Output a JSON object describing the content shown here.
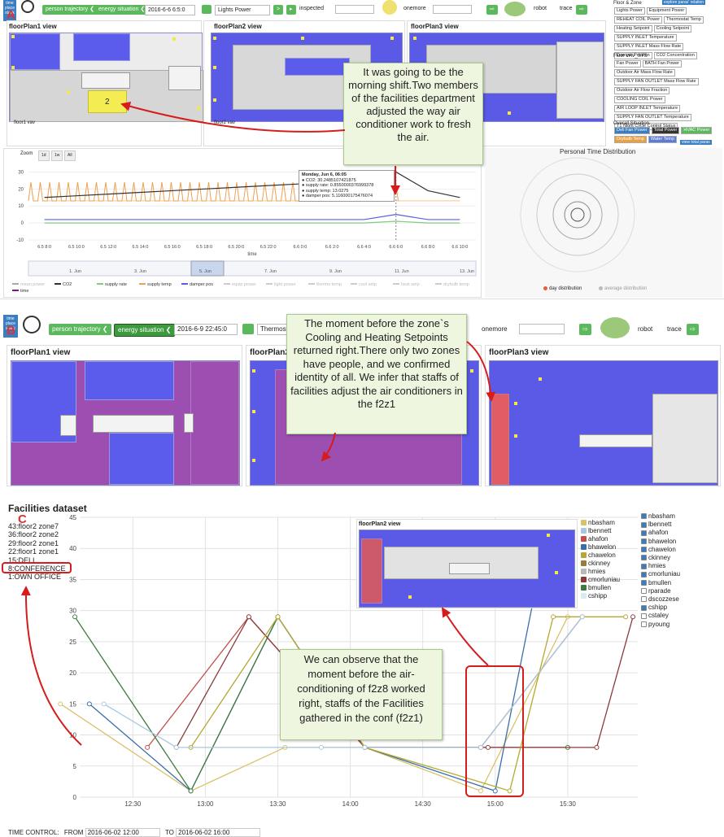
{
  "panelA": {
    "letter": "A",
    "toolbar": {
      "tps": "time\nplace\nstack",
      "person_btn": "person trajectory ❮",
      "energy_btn": "energy situation ❮",
      "date": "2016-6-6 6:5:0",
      "metric": "Lights Power",
      "inspected": "inspected",
      "onemore": "onemore",
      "robot": "robot",
      "trace": "trace"
    },
    "views": [
      "floorPlan1 view",
      "floorPlan2 view",
      "floorPlan3 view"
    ],
    "vav_labels": [
      "floor1 vav",
      "floor2 vav"
    ],
    "side": {
      "h1": "Floor & Zone",
      "explore": "explore paras' relation",
      "floor_tags": [
        "Lights Power",
        "Equipment Power",
        "REHEAT COIL Power",
        "Thermostat Temp",
        "Heating Setpoint",
        "Cooling Setpoint",
        "SUPPLY INLET Temperature",
        "SUPPLY INLET Mass Flow Rate",
        "Damper Position",
        "CO2 Concentration"
      ],
      "h2": "Floor VAV_SYS",
      "vav_tags": [
        "Fan Power",
        "BATH Fan Power",
        "Outdoor Air Mass Flow Rate",
        "SUPPLY FAN OUTLET Mass Flow Rate",
        "Outdoor Air Flow Fraction",
        "COOLING COIL Power",
        "AIR LOOP INLET Temperature",
        "SUPPLY FAN OUTLET Temperature",
        "T1 Night Cycle Control Status"
      ],
      "h3": "Overall Situation",
      "overall_tags": [
        "Deli Fan Power",
        "Total Power",
        "HVAC Power",
        "Drybulb Temp",
        "Water Temp"
      ],
      "view_total": "view total paras"
    },
    "chart": {
      "zoom_label": "Zoom",
      "zoom_opts": [
        "1d",
        "1w",
        "All"
      ],
      "y_ticks": [
        "30",
        "20",
        "10",
        "0",
        "-10"
      ],
      "x_ticks": [
        "6.5 8:0",
        "6.5 10:0",
        "6.5 12:0",
        "6.5 14:0",
        "6.5 16:0",
        "6.5 18:0",
        "6.5 20:0",
        "6.5 22:0",
        "6.6 0:0",
        "6.6 2:0",
        "6.6 4:0",
        "6.6 6:0",
        "6.6 8:0",
        "6.6 10:0"
      ],
      "x_title": "time",
      "nav_ticks": [
        "1. Jun",
        "3. Jun",
        "5. Jun",
        "7. Jun",
        "9. Jun",
        "11. Jun",
        "13. Jun"
      ],
      "tooltip": [
        "Monday, Jun 6, 06:05",
        "● CO2: 30.2485107421875",
        "● supply rate: 0.8550000376999378",
        "● supply temp: 13.0275",
        "● damper pos: 5.116000175476074"
      ],
      "legend": [
        "mean power",
        "CO2",
        "supply rate",
        "supply temp",
        "damper pos",
        "equip power",
        "light power",
        "thermo temp",
        "cool setp",
        "heat setp",
        "drybulb temp",
        "time"
      ]
    },
    "personal": {
      "title": "Personal Time Distribution",
      "legend": [
        "day distribution",
        "average distribution"
      ]
    },
    "callout": "It was going to be the morning shift.Two members of the facilities department adjusted the way air conditioner work to fresh the air.",
    "room_label": "2"
  },
  "panelB": {
    "letter": "B",
    "toolbar": {
      "tps": "time\nplace\nstack",
      "person_btn": "person trajectory ❮",
      "energy_btn": "energy situation ❮",
      "date": "2016-6-9 22:45:0",
      "metric": "Thermostat Temp",
      "onemore": "onemore",
      "robot": "robot",
      "trace": "trace"
    },
    "views": [
      "floorPlan1 view",
      "floorPlan2 view",
      "floorPlan3 view"
    ],
    "callout": "The moment before the zone`s Cooling and Heating Setpoints returned right.There only two zones have people, and we confirmed identity of all. We infer that staffs of facilities adjust the air conditioners  in the f2z1"
  },
  "panelC": {
    "letter": "C",
    "title": "Facilities dataset",
    "zones": [
      "43:floor2 zone7",
      "36:floor2 zone2",
      "29:floor2 zone1",
      "22:floor1 zone1",
      "15:DELI",
      "8:CONFERENCE",
      "1:OWN OFFICE"
    ],
    "y_ticks": [
      "45",
      "40",
      "35",
      "30",
      "25",
      "20",
      "15",
      "10",
      "5",
      "0"
    ],
    "x_ticks": [
      "12:30",
      "13:00",
      "13:30",
      "14:00",
      "14:30",
      "15:00",
      "15:30"
    ],
    "inset_title": "floorPlan2 view",
    "callout": "We can observe that the moment before the air-conditioning of f2z8 worked right, staffs of the Facilities gathered in the conf (f2z1)",
    "legend_series": [
      {
        "name": "nbasham",
        "color": "#d8c36a"
      },
      {
        "name": "lbennett",
        "color": "#a8c8e0"
      },
      {
        "name": "ahafon",
        "color": "#c0504d"
      },
      {
        "name": "bhawelon",
        "color": "#3a6fa8"
      },
      {
        "name": "chawelon",
        "color": "#b5a832"
      },
      {
        "name": "ckinney",
        "color": "#9b7c3e"
      },
      {
        "name": "hmies",
        "color": "#b9b9b9"
      },
      {
        "name": "cmorluniau",
        "color": "#8b3a3a"
      },
      {
        "name": "bmullen",
        "color": "#3f7a3f"
      },
      {
        "name": "cshipp",
        "color": "#d9ecec"
      }
    ],
    "checklist": [
      {
        "name": "nbasham",
        "on": true
      },
      {
        "name": "lbennett",
        "on": true
      },
      {
        "name": "ahafon",
        "on": true
      },
      {
        "name": "bhawelon",
        "on": true
      },
      {
        "name": "chawelon",
        "on": true
      },
      {
        "name": "ckinney",
        "on": true
      },
      {
        "name": "hmies",
        "on": true
      },
      {
        "name": "cmorluniau",
        "on": true
      },
      {
        "name": "bmullen",
        "on": true
      },
      {
        "name": "rparade",
        "on": false
      },
      {
        "name": "dscozzese",
        "on": false
      },
      {
        "name": "cshipp",
        "on": true
      },
      {
        "name": "cstaley",
        "on": false
      },
      {
        "name": "pyoung",
        "on": false
      }
    ],
    "time_control": {
      "label": "TIME CONTROL:",
      "from_label": "FROM",
      "from": "2016-06-02 12:00",
      "to_label": "TO",
      "to": "2016-06-02 16:00"
    }
  },
  "chart_data": [
    {
      "type": "line",
      "title": "",
      "xlabel": "time",
      "ylabel": "",
      "ylim": [
        -10,
        35
      ],
      "x": [
        "6.5 8:0",
        "6.5 10:0",
        "6.5 12:0",
        "6.5 14:0",
        "6.5 16:0",
        "6.5 18:0",
        "6.5 20:0",
        "6.5 22:0",
        "6.6 0:0",
        "6.6 2:0",
        "6.6 4:0",
        "6.6 6:0",
        "6.6 8:0",
        "6.6 10:0"
      ],
      "series": [
        {
          "name": "CO2",
          "values": [
            15,
            16,
            17,
            18,
            19,
            20,
            21,
            22,
            23,
            24,
            25,
            30,
            19,
            15
          ]
        },
        {
          "name": "supply temp",
          "values": [
            13,
            13,
            13,
            13,
            13,
            13,
            13,
            13,
            13,
            13,
            13,
            13,
            13,
            13
          ]
        },
        {
          "name": "damper pos",
          "values": [
            2,
            2,
            2,
            2,
            2,
            2,
            2,
            2,
            2,
            2,
            2,
            5,
            2,
            2
          ]
        },
        {
          "name": "supply rate",
          "values": [
            0,
            0,
            0,
            0,
            0,
            0,
            0,
            0,
            0,
            0,
            0,
            1,
            0,
            0
          ]
        }
      ]
    },
    {
      "type": "line",
      "title": "Facilities dataset",
      "xlabel": "",
      "ylabel": "",
      "ylim": [
        0,
        45
      ],
      "series": [
        {
          "name": "nbasham",
          "points": [
            [
              12,
              15
            ],
            [
              12.9,
              1
            ],
            [
              13.55,
              8
            ],
            [
              14.1,
              8
            ],
            [
              14.9,
              1
            ],
            [
              15.5,
              29
            ]
          ]
        },
        {
          "name": "bhawelon",
          "points": [
            [
              12.2,
              15
            ],
            [
              12.9,
              1
            ],
            [
              13.5,
              29
            ],
            [
              14.1,
              8
            ],
            [
              15,
              1
            ],
            [
              15.3,
              36
            ]
          ]
        },
        {
          "name": "bmullen",
          "points": [
            [
              12.1,
              29
            ],
            [
              12.9,
              1
            ],
            [
              13.5,
              29
            ],
            [
              14.1,
              8
            ],
            [
              14.9,
              8
            ],
            [
              15.5,
              8
            ]
          ]
        },
        {
          "name": "ahafon",
          "points": [
            [
              12.6,
              8
            ],
            [
              13.3,
              29
            ],
            [
              14.1,
              8
            ],
            [
              14.9,
              8
            ],
            [
              15.6,
              29
            ]
          ]
        },
        {
          "name": "cmorluniau",
          "points": [
            [
              12.8,
              8
            ],
            [
              13.3,
              29
            ],
            [
              14.1,
              8
            ],
            [
              14.95,
              8
            ],
            [
              15.7,
              8
            ],
            [
              15.95,
              29
            ]
          ]
        },
        {
          "name": "chawelon",
          "points": [
            [
              12.9,
              8
            ],
            [
              13.5,
              29
            ],
            [
              14.1,
              8
            ],
            [
              15.1,
              1
            ],
            [
              15.4,
              29
            ],
            [
              15.9,
              29
            ]
          ]
        },
        {
          "name": "lbennett",
          "points": [
            [
              12.3,
              15
            ],
            [
              12.8,
              8
            ],
            [
              13.8,
              8
            ],
            [
              14.1,
              8
            ],
            [
              14.9,
              8
            ],
            [
              15.6,
              29
            ]
          ]
        }
      ]
    }
  ]
}
